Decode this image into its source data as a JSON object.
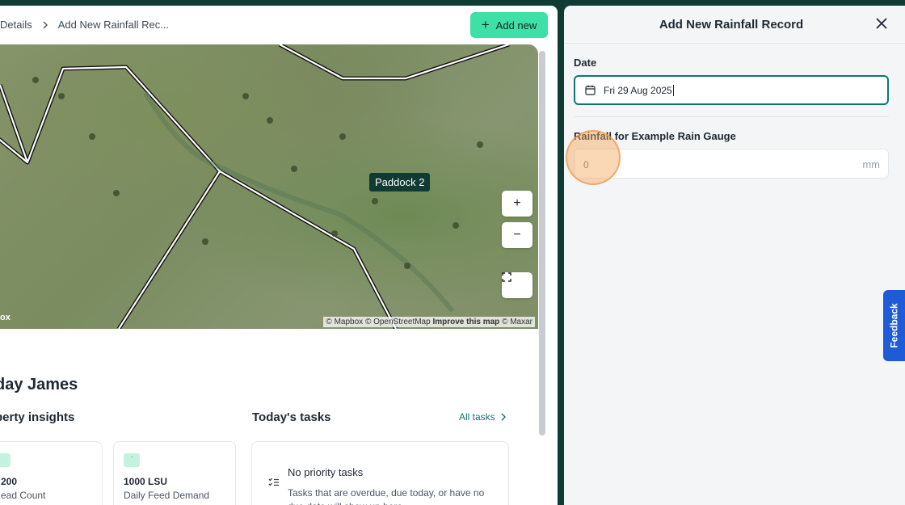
{
  "breadcrumb": {
    "items": [
      "Details",
      "Add New Rainfall Rec..."
    ]
  },
  "header": {
    "add_new_label": "Add new"
  },
  "map": {
    "paddock_label": "Paddock 2",
    "zoom_in": "+",
    "zoom_out": "−",
    "attribution": {
      "mapbox": "© Mapbox",
      "osm": "© OpenStreetMap",
      "improve": "Improve this map",
      "maxar": "© Maxar"
    },
    "logo_text": "ox"
  },
  "dashboard": {
    "greeting": "day James",
    "insights_title": "perty insights",
    "tasks_title": "Today's tasks",
    "all_tasks_label": "All tasks",
    "cards": [
      {
        "value": "200",
        "label": "ead Count"
      },
      {
        "value": "1000  LSU",
        "label": "Daily Feed Demand"
      }
    ],
    "tasks_card": {
      "title": "No priority tasks",
      "description": "Tasks that are overdue, due today, or have no due date will show up here."
    }
  },
  "drawer": {
    "title": "Add New Rainfall Record",
    "date_label": "Date",
    "date_value": "Fri 29 Aug 2025",
    "rainfall_label": "Rainfall for Example Rain Gauge",
    "rainfall_value": "0",
    "rainfall_unit": "mm"
  },
  "feedback_label": "Feedback",
  "colors": {
    "accent": "#3ee0a7",
    "brand_dark": "#0f3b33",
    "focus": "#0f766e",
    "feedback": "#1f5bd6"
  }
}
